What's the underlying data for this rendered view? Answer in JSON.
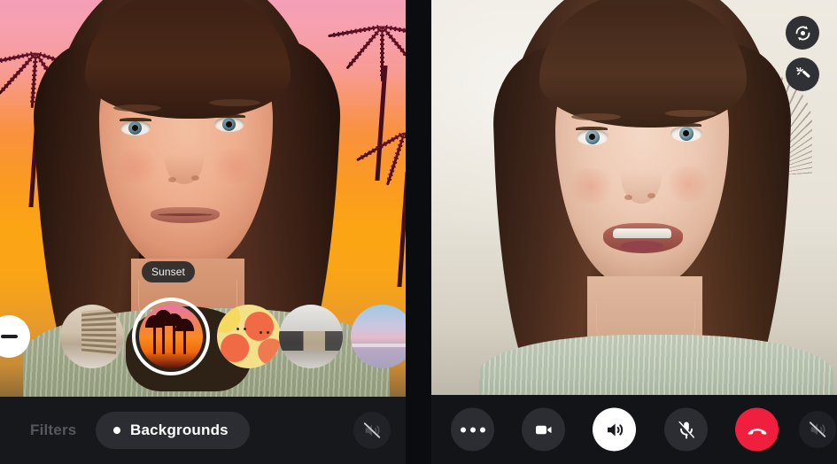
{
  "app": {
    "name": "video-call-background-picker",
    "layout": "two-panel-comparison"
  },
  "left_panel": {
    "name": "self-view-with-virtual-background",
    "video": {
      "subject": "woman-smiling-at-camera",
      "background_applied": "Sunset",
      "background_type": "virtual-background-sunset-palm-trees"
    },
    "tooltip": {
      "label": "Sunset"
    },
    "background_picker": {
      "name": "background-carousel",
      "none_button": {
        "icon": "minus-icon",
        "label": "No background"
      },
      "thumbnails": [
        {
          "id": "hotel",
          "label": "Hotel Lobby",
          "selected": false,
          "icon": "background-thumb-hotel"
        },
        {
          "id": "sunset",
          "label": "Sunset",
          "selected": true,
          "icon": "background-thumb-sunset"
        },
        {
          "id": "abstract",
          "label": "Abstract",
          "selected": false,
          "icon": "background-thumb-abstract"
        },
        {
          "id": "cafe",
          "label": "Cafe",
          "selected": false,
          "icon": "background-thumb-cafe"
        },
        {
          "id": "beach",
          "label": "Beach Sunset",
          "selected": false,
          "icon": "background-thumb-beach"
        }
      ]
    },
    "bottom_bar": {
      "tabs": [
        {
          "id": "filters",
          "label": "Filters",
          "active": false
        },
        {
          "id": "backgrounds",
          "label": "Backgrounds",
          "active": true
        }
      ],
      "mute_button": {
        "icon": "speaker-muted-icon",
        "state": "muted"
      }
    }
  },
  "right_panel": {
    "name": "call-view-plain-background",
    "video": {
      "subject": "woman-talking-to-camera",
      "background_applied": "none",
      "background_type": "real-room-white-wall"
    },
    "floating_buttons": [
      {
        "id": "flip-camera",
        "icon": "camera-flip-icon",
        "label": "Flip camera"
      },
      {
        "id": "effects",
        "icon": "magic-wand-icon",
        "label": "Effects"
      }
    ],
    "call_controls": [
      {
        "id": "more",
        "icon": "more-horizontal-icon",
        "label": "More",
        "state": "default",
        "color": "#2b2d32"
      },
      {
        "id": "camera",
        "icon": "video-camera-icon",
        "label": "Camera",
        "state": "on",
        "color": "#2b2d32"
      },
      {
        "id": "speaker",
        "icon": "speaker-on-icon",
        "label": "Speaker",
        "state": "active",
        "color": "#ffffff"
      },
      {
        "id": "microphone",
        "icon": "microphone-muted-icon",
        "label": "Microphone",
        "state": "muted",
        "color": "#2b2d32"
      },
      {
        "id": "end-call",
        "icon": "phone-hangup-icon",
        "label": "End call",
        "state": "default",
        "color": "#f01f3d"
      },
      {
        "id": "mute",
        "icon": "speaker-muted-icon",
        "label": "Mute",
        "state": "muted",
        "color": "#1e2025"
      }
    ]
  },
  "colors": {
    "bar_background": "#16181c",
    "page_background": "#0b0c0f",
    "accent_end_call": "#f01f3d",
    "active_pill": "#2b2d33",
    "inactive_tab_text": "#55585e",
    "active_text": "#ffffff"
  }
}
